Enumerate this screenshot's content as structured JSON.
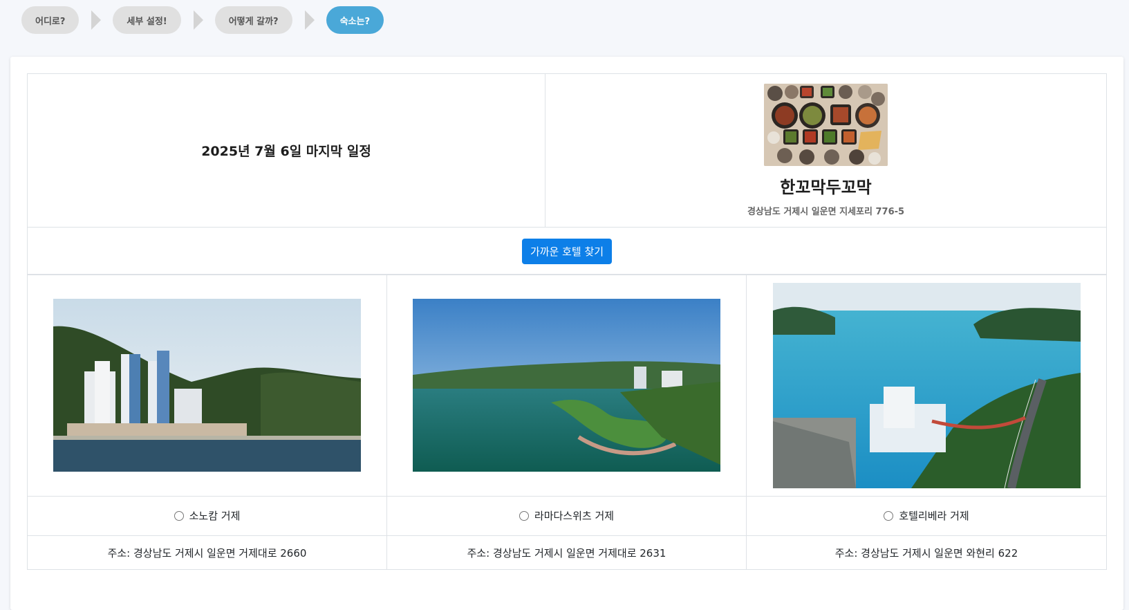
{
  "steps": [
    {
      "label": "어디로?",
      "active": false
    },
    {
      "label": "세부 설정!",
      "active": false
    },
    {
      "label": "어떻게 갈까?",
      "active": false
    },
    {
      "label": "숙소는?",
      "active": true
    }
  ],
  "itinerary": {
    "date_title": "2025년 7월 6일 마지막 일정"
  },
  "restaurant": {
    "name": "한꼬막두꼬막",
    "address": "경상남도 거제시 일운면 지세포리 776-5"
  },
  "find_hotel_button": "가까운 호텔 찾기",
  "hotels": [
    {
      "name": "소노캄 거제",
      "address": "주소: 경상남도 거제시 일운면 거제대로 2660",
      "selected": false
    },
    {
      "name": "라마다스위츠 거제",
      "address": "주소: 경상남도 거제시 일운면 거제대로 2631",
      "selected": false
    },
    {
      "name": "호텔리베라 거제",
      "address": "주소: 경상남도 거제시 일운면 와현리 622",
      "selected": false
    }
  ],
  "colors": {
    "active_step": "#4aa8d8",
    "inactive_step": "#e0e0e0",
    "primary_button": "#0d7fe8"
  }
}
